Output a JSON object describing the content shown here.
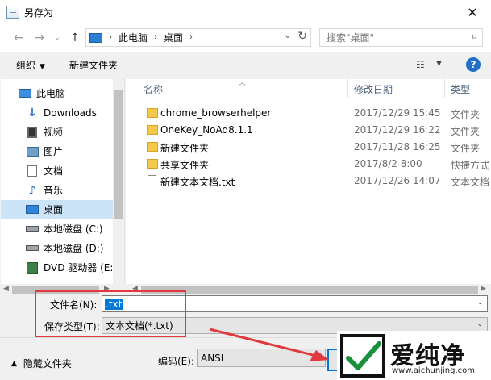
{
  "window": {
    "title": "另存为",
    "close": "✕"
  },
  "address": {
    "crumbs": [
      "此电脑",
      "桌面"
    ]
  },
  "search": {
    "placeholder": "搜索\"桌面\""
  },
  "toolbar": {
    "organize": "组织",
    "new_folder": "新建文件夹",
    "help": "?"
  },
  "nav": {
    "items": [
      {
        "label": "此电脑",
        "icon": "computer-icon"
      },
      {
        "label": "Downloads",
        "icon": "download-arrow-icon"
      },
      {
        "label": "视频",
        "icon": "video-icon"
      },
      {
        "label": "图片",
        "icon": "picture-icon"
      },
      {
        "label": "文档",
        "icon": "document-icon"
      },
      {
        "label": "音乐",
        "icon": "music-note-icon"
      },
      {
        "label": "桌面",
        "icon": "desktop-icon"
      },
      {
        "label": "本地磁盘 (C:)",
        "icon": "drive-icon"
      },
      {
        "label": "本地磁盘 (D:)",
        "icon": "drive-icon"
      },
      {
        "label": "DVD 驱动器 (E:",
        "icon": "dvd-drive-icon"
      }
    ],
    "selected": "桌面"
  },
  "columns": {
    "name": "名称",
    "date": "修改日期",
    "type": "类型"
  },
  "files": [
    {
      "name": "chrome_browserhelper",
      "date": "2017/12/29 15:45",
      "type": "文件夹",
      "icon": "folder-icon"
    },
    {
      "name": "OneKey_NoAd8.1.1",
      "date": "2017/12/29 16:22",
      "type": "文件夹",
      "icon": "folder-icon"
    },
    {
      "name": "新建文件夹",
      "date": "2017/11/28 16:25",
      "type": "文件夹",
      "icon": "folder-icon"
    },
    {
      "name": "共享文件夹",
      "date": "2017/8/2 8:00",
      "type": "快捷方式",
      "icon": "shortcut-folder-icon"
    },
    {
      "name": "新建文本文档.txt",
      "date": "2017/12/26 14:07",
      "type": "文本文档",
      "icon": "text-file-icon"
    }
  ],
  "save": {
    "filename_label": "文件名(N):",
    "filename_value": ".txt",
    "type_label": "保存类型(T):",
    "type_value": "文本文档(*.txt)",
    "encoding_label": "编码(E):",
    "encoding_value": "ANSI",
    "hide_folders": "隐藏文件夹"
  },
  "watermark": {
    "brand": "爱纯净",
    "url": "www.aichunjing.com"
  },
  "colors": {
    "accent": "#0078d7",
    "highlight": "#e0393e",
    "selected_nav": "#cce4f7"
  }
}
